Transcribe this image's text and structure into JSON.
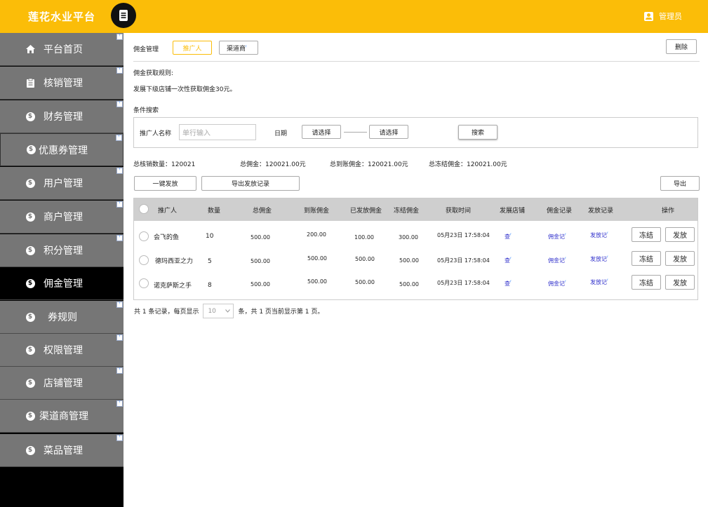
{
  "app": {
    "brand": "莲花水业平台",
    "user": "管理员"
  },
  "sidebar": {
    "items": [
      {
        "label": "平台首页",
        "icon": "home-icon"
      },
      {
        "label": "核销管理",
        "icon": "clipboard-icon"
      },
      {
        "label": "财务管理",
        "icon": "dollar-icon"
      },
      {
        "label": "优惠券管理",
        "icon": "dollar-icon"
      },
      {
        "label": "用户管理",
        "icon": "dollar-icon"
      },
      {
        "label": "商户管理",
        "icon": "dollar-icon"
      },
      {
        "label": "积分管理",
        "icon": "dollar-icon"
      },
      {
        "label": "佣金管理",
        "icon": "dollar-icon",
        "active": true
      },
      {
        "label": "券规则",
        "icon": "dollar-icon"
      },
      {
        "label": "权限管理",
        "icon": "dollar-icon"
      },
      {
        "label": "店铺管理",
        "icon": "dollar-icon"
      },
      {
        "label": "渠道商管理",
        "icon": "dollar-icon"
      },
      {
        "label": "菜品管理",
        "icon": "dollar-icon"
      }
    ]
  },
  "header": {
    "title": "佣金管理",
    "tabs": [
      {
        "label": "推广人"
      },
      {
        "label": "渠道商"
      }
    ],
    "delete_label": "删除"
  },
  "rules": {
    "title": "佣金获取规则:",
    "text": "发展下级店铺一次性获取佣金30元。"
  },
  "search": {
    "title": "条件搜索",
    "name_label": "推广人名称",
    "name_placeholder": "单行输入",
    "date_label": "日期",
    "date_start": "请选择",
    "date_end": "请选择",
    "search_label": "搜索"
  },
  "summary": {
    "total_count": "总核销数量：120021",
    "total_commission": "总佣金：120021.00元",
    "arrived": "总到账佣金：120021.00元",
    "frozen": "总冻结佣金：120021.00元"
  },
  "actions": {
    "one_click": "一键发放",
    "export_record": "导出发放记录",
    "export": "导出"
  },
  "table": {
    "headers": [
      "推广人",
      "数量",
      "总佣金",
      "到账佣金",
      "已发放佣金",
      "冻结佣金",
      "获取时间",
      "发展店铺",
      "佣金记录",
      "发放记录",
      "操作"
    ],
    "rows": [
      {
        "name": "会飞的鱼",
        "qty": "10",
        "total": "500.00",
        "arrived": "200.00",
        "paid": "100.00",
        "frozen": "300.00",
        "time": "05月23日 17:58:04",
        "shop_link": "查",
        "commission_link": "佣金记",
        "payout_link": "发放记",
        "freeze": "冻结",
        "pay": "发放"
      },
      {
        "name": "德玛西亚之力",
        "qty": "5",
        "total": "500.00",
        "arrived": "500.00",
        "paid": "500.00",
        "frozen": "500.00",
        "time": "05月23日 17:58:04",
        "shop_link": "查",
        "commission_link": "佣金记",
        "payout_link": "发放记",
        "freeze": "冻结",
        "pay": "发放"
      },
      {
        "name": "诺克萨斯之手",
        "qty": "8",
        "total": "500.00",
        "arrived": "500.00",
        "paid": "500.00",
        "frozen": "500.00",
        "time": "05月23日 17:58:04",
        "shop_link": "查",
        "commission_link": "佣金记",
        "payout_link": "发放记",
        "freeze": "冻结",
        "pay": "发放"
      }
    ]
  },
  "pager": {
    "prefix": "共 1 条记录，每页显示",
    "page_size": "10",
    "suffix": "条，共 1 页当前显示第 1 页。"
  },
  "colors": {
    "accent": "#fbbd08",
    "sidebar": "#767676",
    "active": "#000000"
  }
}
